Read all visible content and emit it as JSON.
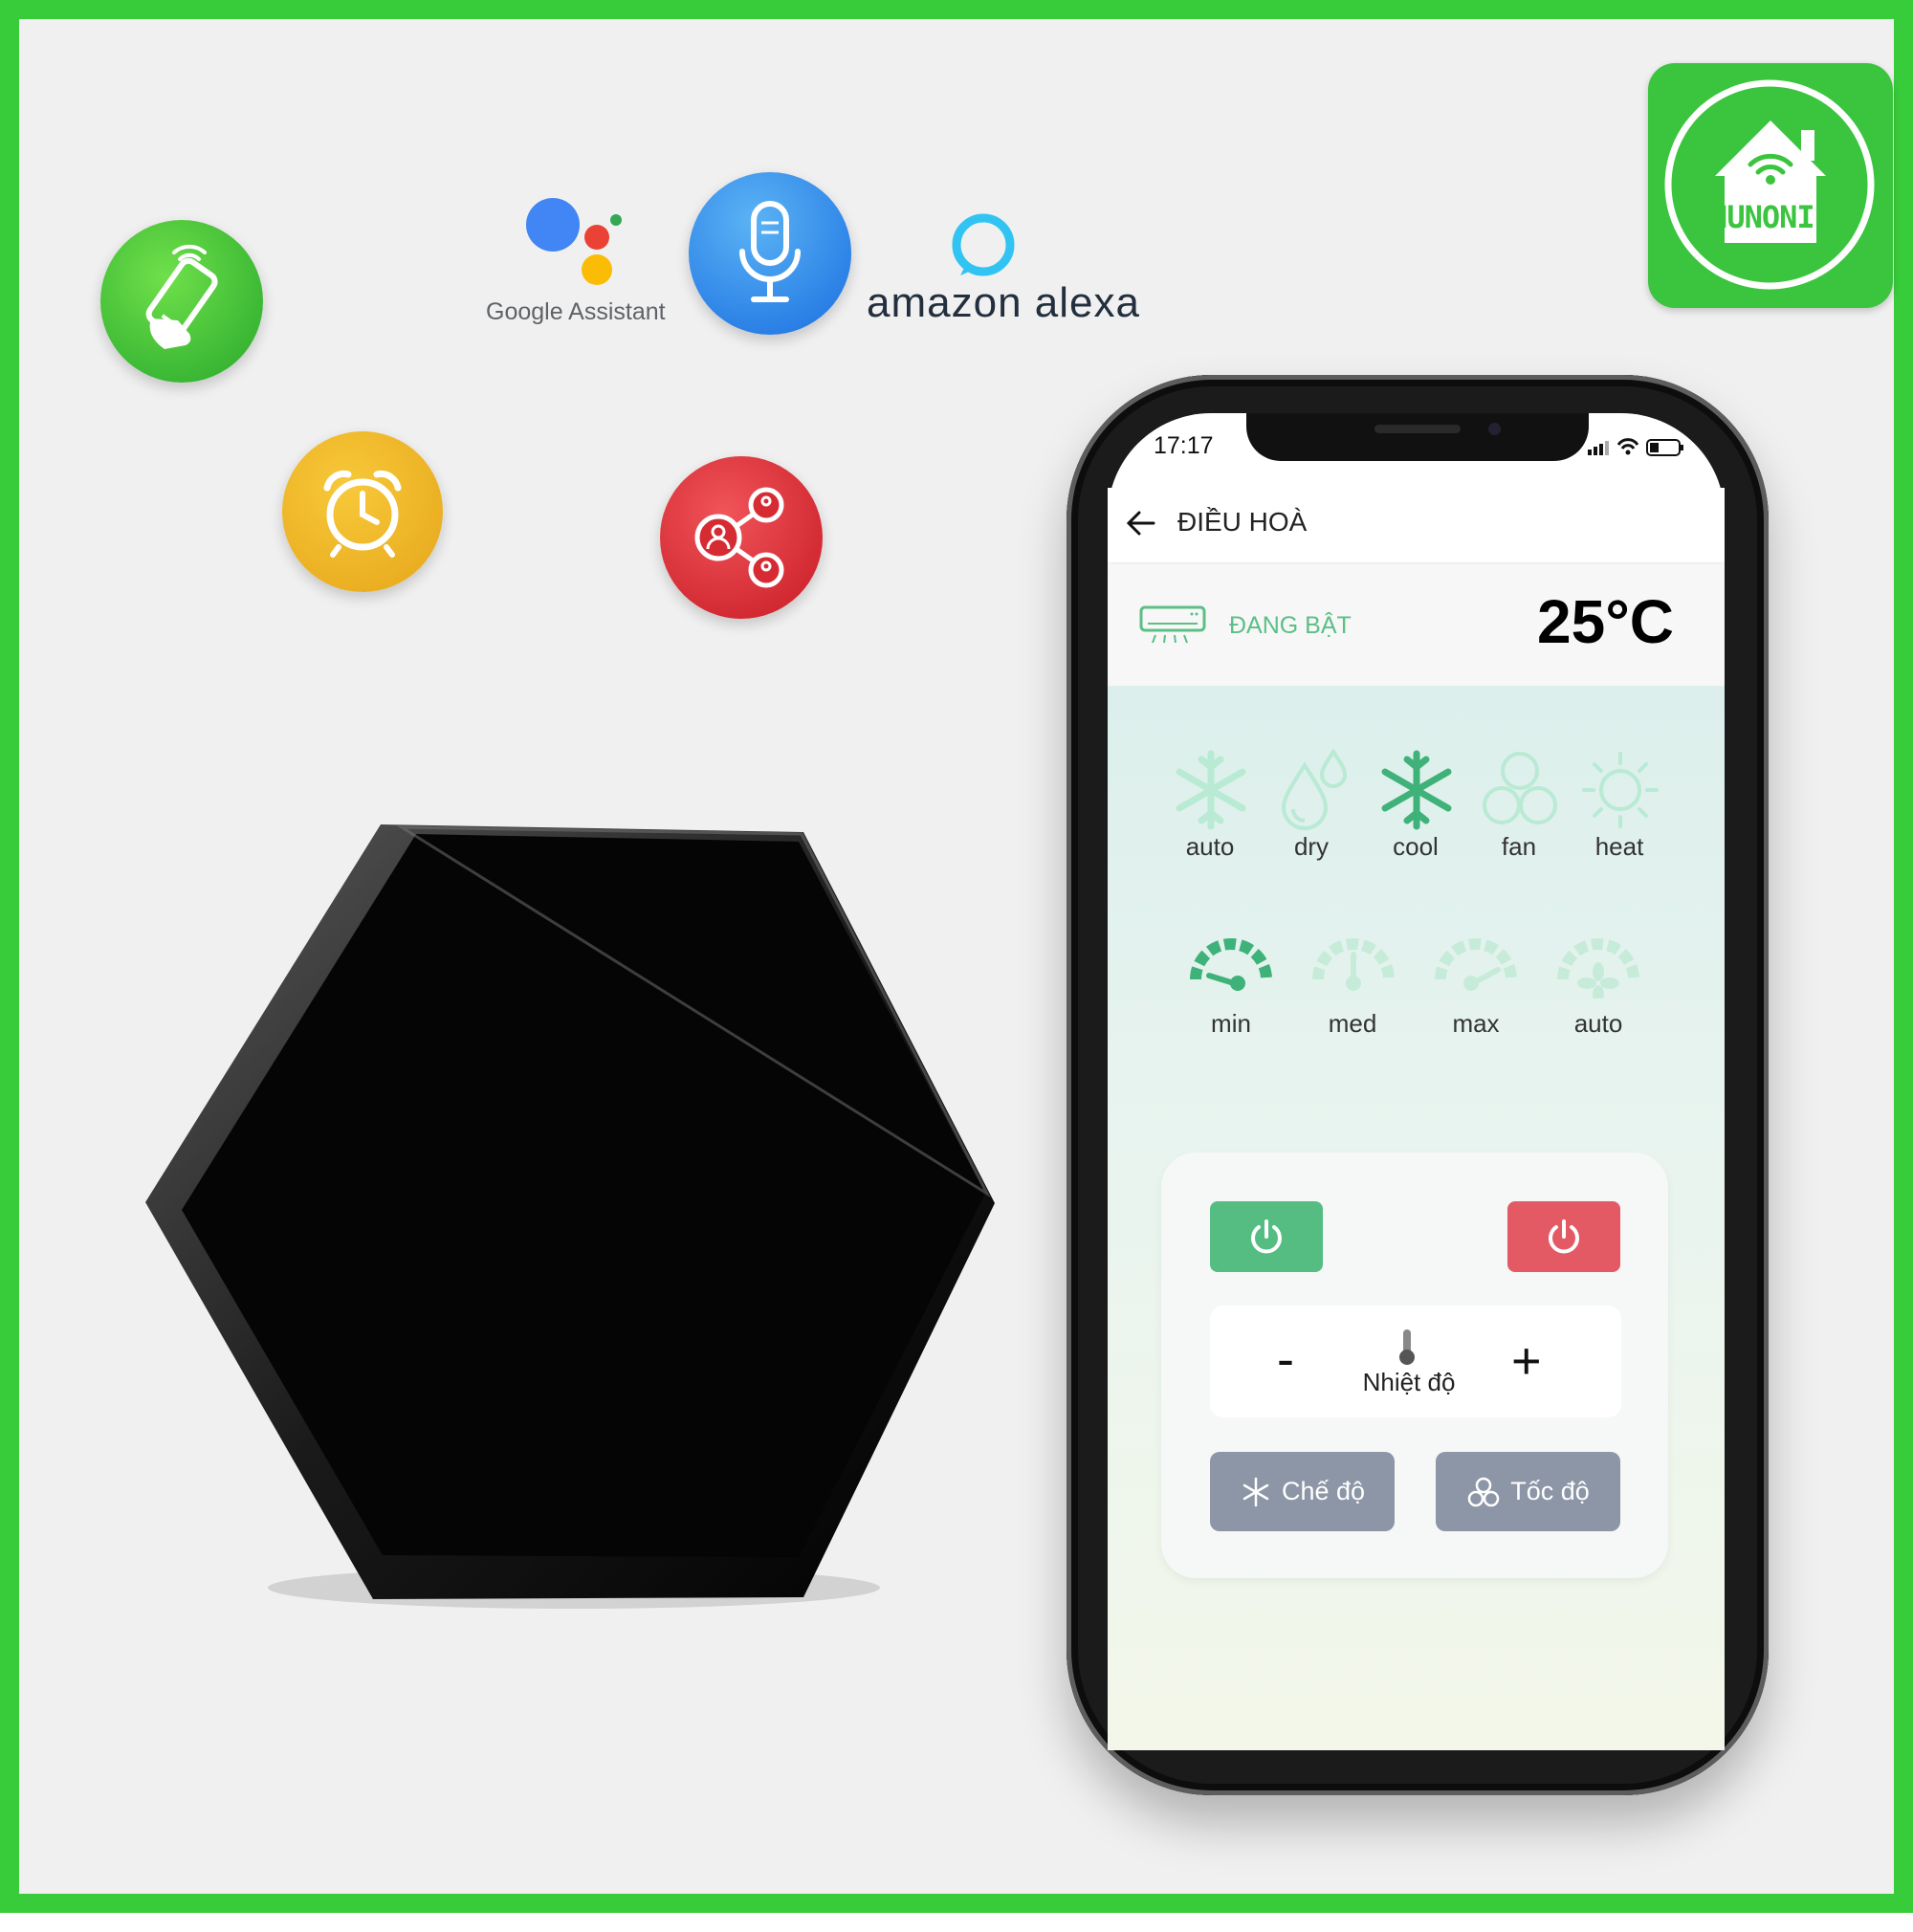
{
  "brand": {
    "logo_text": "HUNONIC"
  },
  "features": {
    "google_assistant_label": "Google Assistant",
    "amazon_alexa_label": "amazon alexa"
  },
  "colors": {
    "border": "#39cc3a",
    "accent_green": "#55bd82",
    "off_red": "#e45a64",
    "grey_button": "#8c96a6"
  },
  "phone": {
    "status_bar": {
      "time": "17:17"
    },
    "app_bar": {
      "title": "ĐIỀU HOÀ"
    },
    "device": {
      "status": "ĐANG BẬT",
      "temperature": "25°C"
    },
    "modes": [
      {
        "label": "auto",
        "icon": "snowflake-icon",
        "selected": false
      },
      {
        "label": "dry",
        "icon": "droplets-icon",
        "selected": false
      },
      {
        "label": "cool",
        "icon": "snowflake-icon",
        "selected": true
      },
      {
        "label": "fan",
        "icon": "fan-icon",
        "selected": false
      },
      {
        "label": "heat",
        "icon": "sun-icon",
        "selected": false
      }
    ],
    "fan_speeds": [
      {
        "label": "min",
        "icon": "gauge-icon",
        "selected": true
      },
      {
        "label": "med",
        "icon": "gauge-icon",
        "selected": false
      },
      {
        "label": "max",
        "icon": "gauge-icon",
        "selected": false
      },
      {
        "label": "auto",
        "icon": "fan-gauge-icon",
        "selected": false
      }
    ],
    "controls": {
      "minus_label": "-",
      "plus_label": "+",
      "temperature_label": "Nhiệt độ",
      "mode_button": "Chế độ",
      "speed_button": "Tốc độ"
    }
  }
}
